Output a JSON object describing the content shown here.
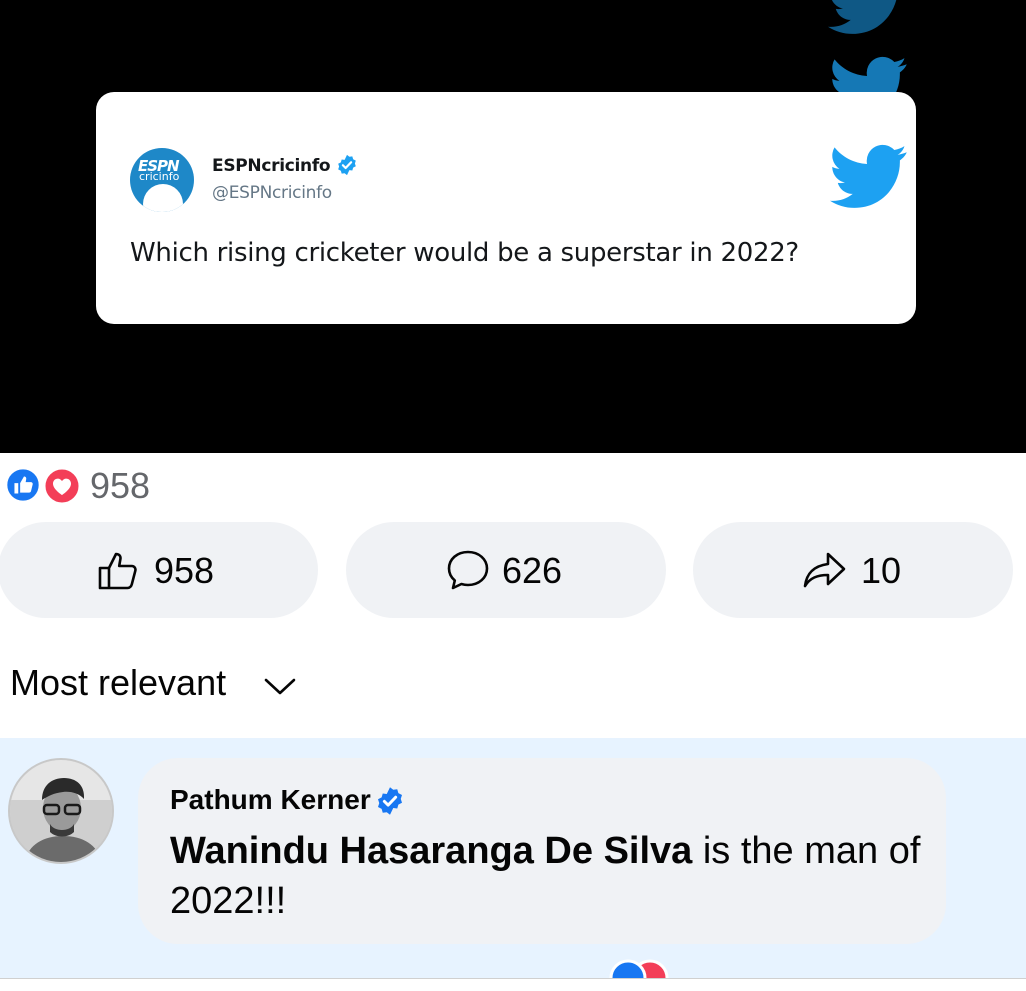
{
  "media": {
    "tweet": {
      "account_name": "ESPNcricinfo",
      "handle": "@ESPNcricinfo",
      "text": "Which rising cricketer would be a superstar in 2022?",
      "logo_text_top": "ESPN",
      "logo_text_bottom": "cricinfo",
      "verified_icon": "verified-badge-icon"
    },
    "decorations": [
      "twitter-bird-icon",
      "twitter-bird-icon",
      "twitter-bird-icon"
    ]
  },
  "reactions": {
    "icons": [
      "like-reaction-icon",
      "love-reaction-icon"
    ],
    "count": "958"
  },
  "actions": {
    "like": {
      "icon": "thumbs-up-icon",
      "count": "958"
    },
    "comment": {
      "icon": "comment-bubble-icon",
      "count": "626"
    },
    "share": {
      "icon": "share-arrow-icon",
      "count": "10"
    }
  },
  "sort": {
    "label": "Most relevant",
    "icon": "chevron-down-icon"
  },
  "comment": {
    "author": "Pathum Kerner",
    "verified_icon": "verified-badge-icon",
    "mention": "Wanindu Hasaranga De Silva",
    "text_after": " is the man of 2022!!!"
  },
  "colors": {
    "facebook_blue": "#1877f2",
    "love_red": "#f33e58",
    "twitter_blue": "#1da1f2",
    "comment_highlight": "#e7f3ff",
    "pill_bg": "#f0f2f5"
  }
}
